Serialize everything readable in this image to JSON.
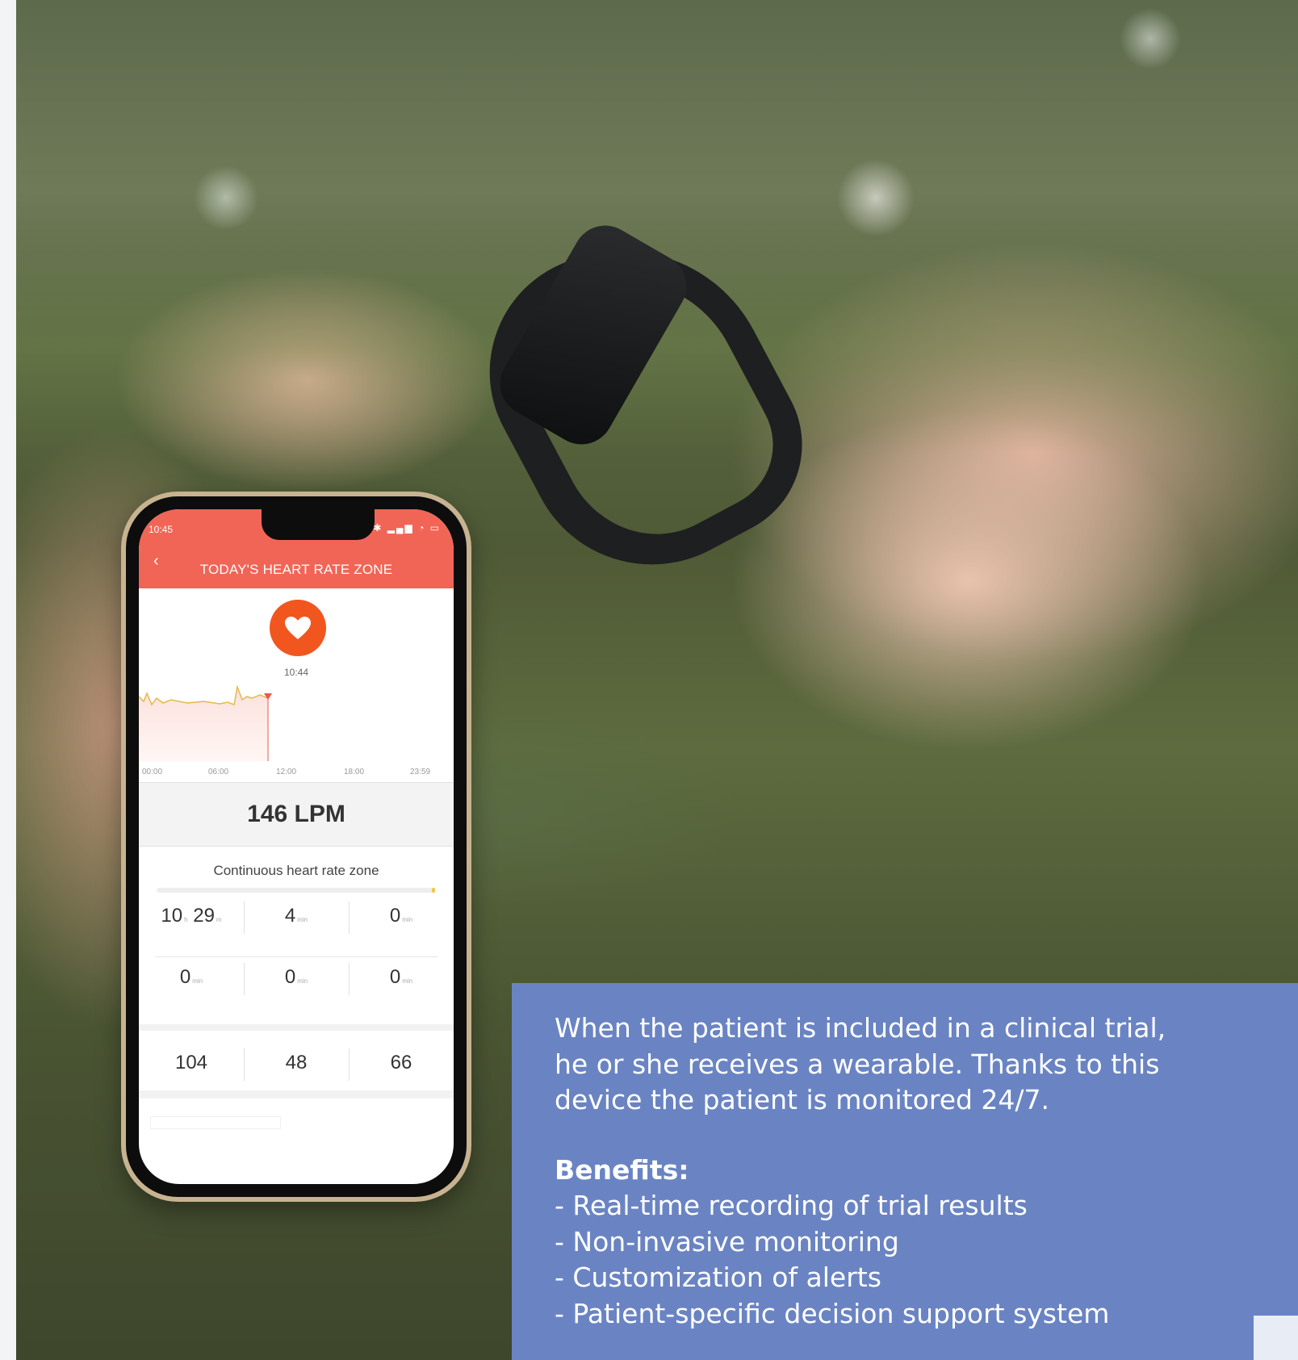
{
  "phone_app": {
    "status_time": "10:45",
    "title": "TODAY'S HEART RATE ZONE",
    "chart_time": "10:44",
    "axis_labels": [
      "00:00",
      "06:00",
      "12:00",
      "18:00",
      "23:59"
    ],
    "heart_rate": "146 LPM",
    "zone_title": "Continuous heart rate zone",
    "zones_row1": [
      {
        "value": "10",
        "unit": "h",
        "value2": "29",
        "unit2": "m"
      },
      {
        "value": "4",
        "unit": "min"
      },
      {
        "value": "0",
        "unit": "min"
      }
    ],
    "zones_row2": [
      {
        "value": "0",
        "unit": "min"
      },
      {
        "value": "0",
        "unit": "min"
      },
      {
        "value": "0",
        "unit": "min"
      }
    ],
    "stats": [
      "104",
      "48",
      "66"
    ],
    "accent_color": "#f16556",
    "heart_color": "#f1561f"
  },
  "info_panel": {
    "intro": "When the patient is included in a clinical trial, he or she receives a wearable. Thanks to this device the patient is monitored 24/7.",
    "benefits_title": "Benefits:",
    "benefits": [
      "- Real-time recording of trial results",
      "- Non-invasive monitoring",
      "- Customization of alerts",
      "- Patient-specific decision support system"
    ],
    "background_color": "#6a84c3"
  }
}
